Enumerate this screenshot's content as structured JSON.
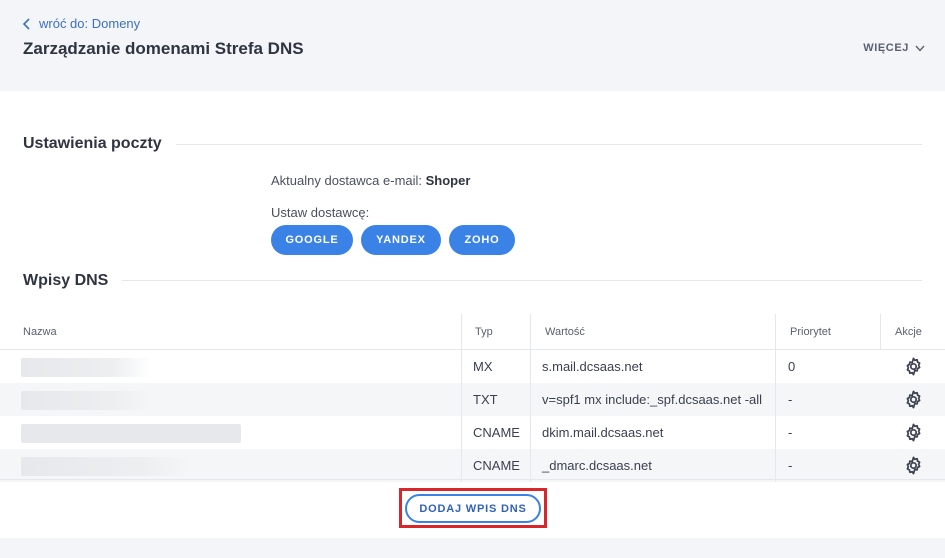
{
  "header": {
    "back_link": "wróć do: Domeny",
    "title": "Zarządzanie domenami Strefa DNS",
    "more_label": "WIĘCEJ"
  },
  "mail": {
    "section_title": "Ustawienia poczty",
    "current_provider_prefix": "Aktualny dostawca e-mail: ",
    "current_provider": "Shoper",
    "set_provider_label": "Ustaw dostawcę:",
    "providers": [
      "GOOGLE",
      "YANDEX",
      "ZOHO"
    ]
  },
  "dns": {
    "section_title": "Wpisy DNS",
    "columns": {
      "name": "Nazwa",
      "type": "Typ",
      "value": "Wartość",
      "priority": "Priorytet",
      "actions": "Akcje"
    },
    "rows": [
      {
        "type": "MX",
        "value": "s.mail.dcsaas.net",
        "priority": "0"
      },
      {
        "type": "TXT",
        "value": "v=spf1 mx include:_spf.dcsaas.net -all",
        "priority": "-"
      },
      {
        "type": "CNAME",
        "value": "dkim.mail.dcsaas.net",
        "priority": "-"
      },
      {
        "type": "CNAME",
        "value": "_dmarc.dcsaas.net",
        "priority": "-"
      }
    ],
    "add_button": "DODAJ WPIS DNS"
  },
  "colors": {
    "accent": "#3b82e6",
    "highlight_border": "#d9262b",
    "link": "#3d6fc4"
  },
  "icons": {
    "back": "chevron-left-icon",
    "more": "chevron-down-icon",
    "row_action": "gear-icon"
  }
}
